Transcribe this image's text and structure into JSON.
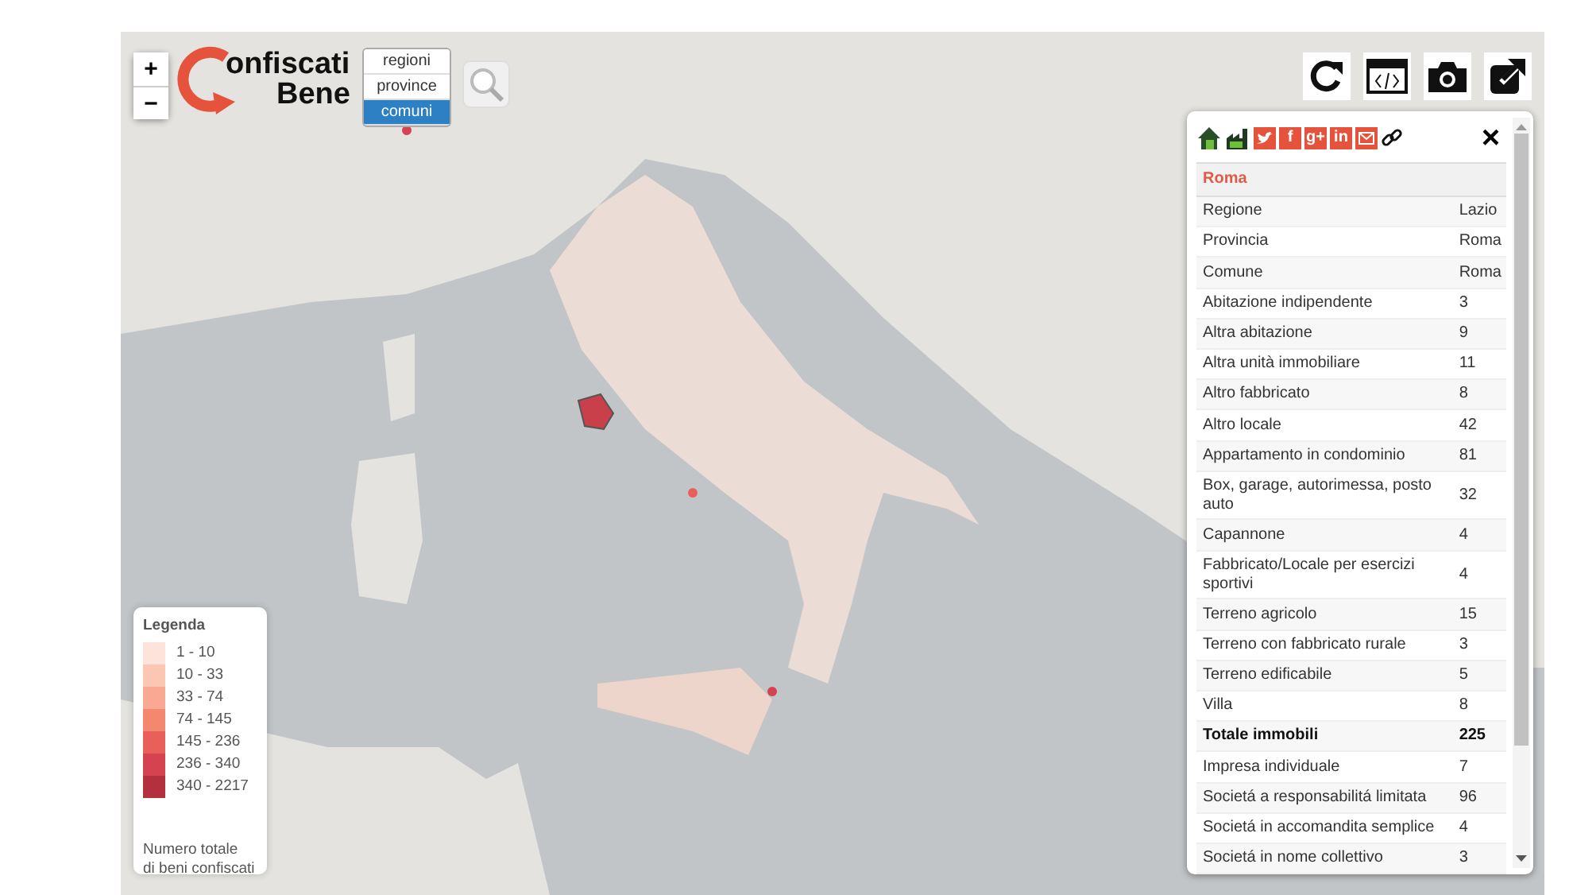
{
  "zoom_controls": [
    "+",
    "−"
  ],
  "logo": {
    "line_1": "onfiscati",
    "line_2": "Bene"
  },
  "layer_selector": [
    {
      "label": "regioni",
      "selected": false
    },
    {
      "label": "province",
      "selected": false
    },
    {
      "label": "comuni",
      "selected": true
    }
  ],
  "toolbar": [
    {
      "kind": "reload"
    },
    {
      "kind": "embed"
    },
    {
      "kind": "camera"
    },
    {
      "kind": "external"
    }
  ],
  "info_panel": {
    "header_icons": [
      {
        "kind": "house"
      },
      {
        "kind": "factory"
      },
      {
        "kind": "bird"
      },
      {
        "kind": "text",
        "label": "f"
      },
      {
        "kind": "text",
        "label": "g+"
      },
      {
        "kind": "text",
        "label": "in"
      },
      {
        "kind": "mail"
      },
      {
        "kind": "link"
      }
    ],
    "close": "×",
    "title": "Roma",
    "rows": [
      {
        "label": "Regione",
        "value": "Lazio",
        "kind": "normal"
      },
      {
        "label": "Provincia",
        "value": "Roma",
        "kind": "normal"
      },
      {
        "label": "Comune",
        "value": "Roma",
        "kind": "normal"
      },
      {
        "label": "Abitazione indipendente",
        "value": "3",
        "kind": "normal"
      },
      {
        "label": "Altra abitazione",
        "value": "9",
        "kind": "normal"
      },
      {
        "label": "Altra unità immobiliare",
        "value": "11",
        "kind": "normal"
      },
      {
        "label": "Altro fabbricato",
        "value": "8",
        "kind": "normal"
      },
      {
        "label": "Altro locale",
        "value": "42",
        "kind": "normal"
      },
      {
        "label": "Appartamento in condominio",
        "value": "81",
        "kind": "normal"
      },
      {
        "label": "Box, garage, autorimessa, posto auto",
        "value": "32",
        "kind": "normal"
      },
      {
        "label": "Capannone",
        "value": "4",
        "kind": "normal"
      },
      {
        "label": "Fabbricato/Locale per esercizi sportivi",
        "value": "4",
        "kind": "normal"
      },
      {
        "label": "Terreno agricolo",
        "value": "15",
        "kind": "normal"
      },
      {
        "label": "Terreno con fabbricato rurale",
        "value": "3",
        "kind": "normal"
      },
      {
        "label": "Terreno edificabile",
        "value": "5",
        "kind": "normal"
      },
      {
        "label": "Villa",
        "value": "8",
        "kind": "normal"
      },
      {
        "label": "Totale immobili",
        "value": "225",
        "kind": "total"
      },
      {
        "label": "Impresa individuale",
        "value": "7",
        "kind": "normal"
      },
      {
        "label": "Societá a responsabilitá limitata",
        "value": "96",
        "kind": "normal"
      },
      {
        "label": "Societá in accomandita semplice",
        "value": "4",
        "kind": "normal"
      },
      {
        "label": "Societá in nome collettivo",
        "value": "3",
        "kind": "normal"
      }
    ]
  },
  "legend": {
    "title": "Legenda",
    "items": [
      {
        "label": "1 - 10",
        "color": "#fde3da"
      },
      {
        "label": "10 - 33",
        "color": "#fbc6b2"
      },
      {
        "label": "33 - 74",
        "color": "#f9a993"
      },
      {
        "label": "74 - 145",
        "color": "#f4876f"
      },
      {
        "label": "145 - 236",
        "color": "#e9605a"
      },
      {
        "label": "236 - 340",
        "color": "#d4434f"
      },
      {
        "label": "340 - 2217",
        "color": "#b3303f"
      }
    ],
    "note": [
      "Numero totale",
      "di beni confiscati"
    ]
  }
}
